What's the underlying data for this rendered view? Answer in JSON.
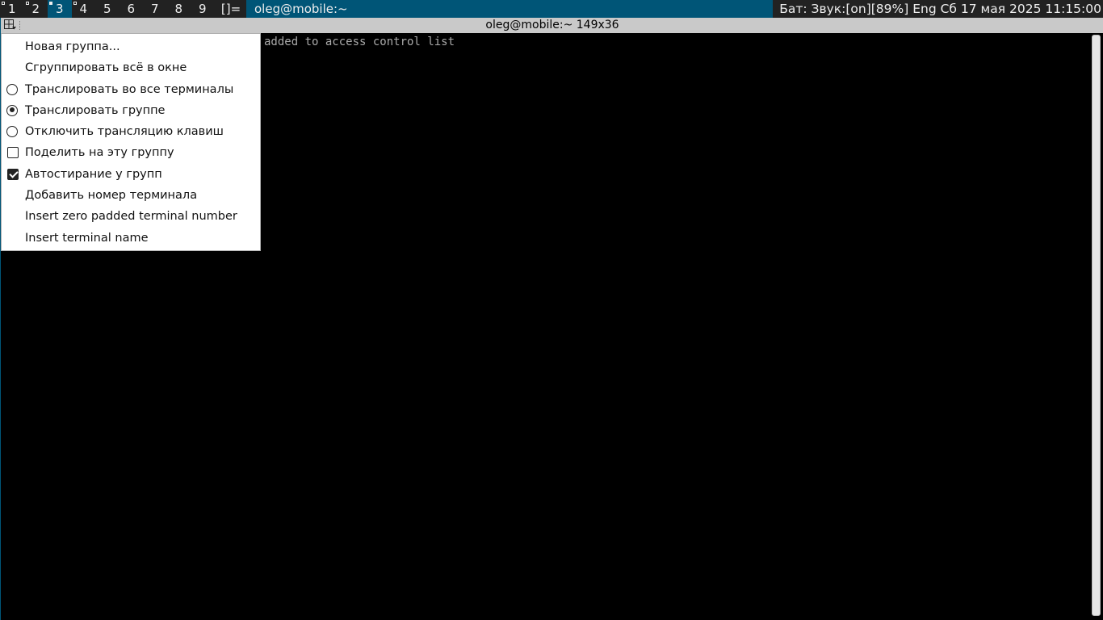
{
  "topbar": {
    "tags": [
      {
        "label": "1",
        "occupied": true,
        "filled": false,
        "active": false
      },
      {
        "label": "2",
        "occupied": true,
        "filled": false,
        "active": false
      },
      {
        "label": "3",
        "occupied": true,
        "filled": true,
        "active": true
      },
      {
        "label": "4",
        "occupied": true,
        "filled": false,
        "active": false
      },
      {
        "label": "5",
        "occupied": false,
        "filled": false,
        "active": false
      },
      {
        "label": "6",
        "occupied": false,
        "filled": false,
        "active": false
      },
      {
        "label": "7",
        "occupied": false,
        "filled": false,
        "active": false
      },
      {
        "label": "8",
        "occupied": false,
        "filled": false,
        "active": false
      },
      {
        "label": "9",
        "occupied": false,
        "filled": false,
        "active": false
      }
    ],
    "layout_symbol": "[]=",
    "window_title": "oleg@mobile:~",
    "status": "Бат: Звук:[on][89%] Eng Сб 17 мая 2025 11:15:00"
  },
  "terminal": {
    "title": "oleg@mobile:~ 149x36",
    "visible_text": "added to access control list"
  },
  "menu": {
    "items": [
      {
        "label": "Новая группа...",
        "control": "none",
        "checked": false
      },
      {
        "label": "Сгруппировать всё в окне",
        "control": "none",
        "checked": false
      },
      {
        "label": "Транслировать во все терминалы",
        "control": "radio",
        "checked": false
      },
      {
        "label": "Транслировать группе",
        "control": "radio",
        "checked": true
      },
      {
        "label": "Отключить трансляцию клавиш",
        "control": "radio",
        "checked": false
      },
      {
        "label": "Поделить на эту группу",
        "control": "checkbox",
        "checked": false
      },
      {
        "label": "Автостирание у групп",
        "control": "checkbox",
        "checked": true
      },
      {
        "label": "Добавить номер терминала",
        "control": "none",
        "checked": false
      },
      {
        "label": "Insert zero padded terminal number",
        "control": "none",
        "checked": false
      },
      {
        "label": "Insert terminal name",
        "control": "none",
        "checked": false
      }
    ]
  },
  "colors": {
    "bar_bg": "#222222",
    "accent": "#005577",
    "bar_fg": "#eeeeee",
    "titlebar_bg": "#c9c9c9",
    "terminal_bg": "#000000",
    "terminal_fg": "#aaaaaa"
  }
}
